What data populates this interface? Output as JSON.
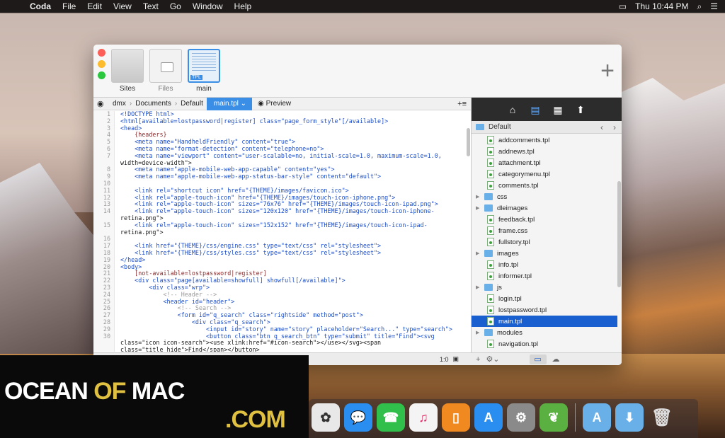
{
  "menubar": {
    "apple": "",
    "app": "Coda",
    "items": [
      "File",
      "Edit",
      "View",
      "Text",
      "Go",
      "Window",
      "Help"
    ],
    "clock": "Thu 10:44 PM"
  },
  "modes": {
    "sites": "Sites",
    "files": "Files",
    "editor": "main",
    "editor_tag": "TPL"
  },
  "path": {
    "segments": [
      "dmx",
      "Documents",
      "Default"
    ],
    "active": "main.tpl",
    "preview": "Preview"
  },
  "code_lines": [
    {
      "n": "1",
      "t": "<!DOCTYPE html>"
    },
    {
      "n": "2",
      "t": "<html[available=lostpassword|register] class=\"page_form_style\"[/available]>"
    },
    {
      "n": "3",
      "t": "<head>"
    },
    {
      "n": "4",
      "t": "    {headers}"
    },
    {
      "n": "5",
      "t": "    <meta name=\"HandheldFriendly\" content=\"true\">"
    },
    {
      "n": "6",
      "t": "    <meta name=\"format-detection\" content=\"telephone=no\">"
    },
    {
      "n": "7",
      "t": "    <meta name=\"viewport\" content=\"user-scalable=no, initial-scale=1.0, maximum-scale=1.0,"
    },
    {
      "n": "",
      "t": "width=device-width\">"
    },
    {
      "n": "8",
      "t": "    <meta name=\"apple-mobile-web-app-capable\" content=\"yes\">"
    },
    {
      "n": "9",
      "t": "    <meta name=\"apple-mobile-web-app-status-bar-style\" content=\"default\">"
    },
    {
      "n": "10",
      "t": ""
    },
    {
      "n": "11",
      "t": "    <link rel=\"shortcut icon\" href=\"{THEME}/images/favicon.ico\">"
    },
    {
      "n": "12",
      "t": "    <link rel=\"apple-touch-icon\" href=\"{THEME}/images/touch-icon-iphone.png\">"
    },
    {
      "n": "13",
      "t": "    <link rel=\"apple-touch-icon\" sizes=\"76x76\" href=\"{THEME}/images/touch-icon-ipad.png\">"
    },
    {
      "n": "14",
      "t": "    <link rel=\"apple-touch-icon\" sizes=\"120x120\" href=\"{THEME}/images/touch-icon-iphone-"
    },
    {
      "n": "",
      "t": "retina.png\">"
    },
    {
      "n": "15",
      "t": "    <link rel=\"apple-touch-icon\" sizes=\"152x152\" href=\"{THEME}/images/touch-icon-ipad-"
    },
    {
      "n": "",
      "t": "retina.png\">"
    },
    {
      "n": "16",
      "t": ""
    },
    {
      "n": "17",
      "t": "    <link href=\"{THEME}/css/engine.css\" type=\"text/css\" rel=\"stylesheet\">"
    },
    {
      "n": "18",
      "t": "    <link href=\"{THEME}/css/styles.css\" type=\"text/css\" rel=\"stylesheet\">"
    },
    {
      "n": "19",
      "t": "</head>"
    },
    {
      "n": "20",
      "t": "<body>"
    },
    {
      "n": "21",
      "t": "    [not-available=lostpassword|register]"
    },
    {
      "n": "22",
      "t": "    <div class=\"page[available=showfull] showfull[/available]\">"
    },
    {
      "n": "23",
      "t": "        <div class=\"wrp\">"
    },
    {
      "n": "24",
      "t": "            <!-- Header -->"
    },
    {
      "n": "25",
      "t": "            <header id=\"header\">"
    },
    {
      "n": "26",
      "t": "                <!-- Search -->"
    },
    {
      "n": "27",
      "t": "                <form id=\"q_search\" class=\"rightside\" method=\"post\">"
    },
    {
      "n": "28",
      "t": "                    <div class=\"q_search\">"
    },
    {
      "n": "29",
      "t": "                        <input id=\"story\" name=\"story\" placeholder=\"Search...\" type=\"search\">"
    },
    {
      "n": "30",
      "t": "                        <button class=\"btn q_search_btn\" type=\"submit\" title=\"Find\"><svg"
    },
    {
      "n": "",
      "t": "class=\"icon icon-search\"><use xlink:href=\"#icon-search\"></use></svg><span"
    },
    {
      "n": "",
      "t": "class=\"title_hide\">Find</span></button>"
    }
  ],
  "status": {
    "position": "1:0"
  },
  "sidebar": {
    "folder": "Default",
    "files": [
      {
        "name": "addcomments.tpl",
        "kind": "file"
      },
      {
        "name": "addnews.tpl",
        "kind": "file"
      },
      {
        "name": "attachment.tpl",
        "kind": "file"
      },
      {
        "name": "categorymenu.tpl",
        "kind": "file"
      },
      {
        "name": "comments.tpl",
        "kind": "file"
      },
      {
        "name": "css",
        "kind": "folder"
      },
      {
        "name": "dleimages",
        "kind": "folder"
      },
      {
        "name": "feedback.tpl",
        "kind": "file"
      },
      {
        "name": "frame.css",
        "kind": "file"
      },
      {
        "name": "fullstory.tpl",
        "kind": "file"
      },
      {
        "name": "images",
        "kind": "folder"
      },
      {
        "name": "info.tpl",
        "kind": "file"
      },
      {
        "name": "informer.tpl",
        "kind": "file"
      },
      {
        "name": "js",
        "kind": "folder"
      },
      {
        "name": "login.tpl",
        "kind": "file"
      },
      {
        "name": "lostpassword.tpl",
        "kind": "file"
      },
      {
        "name": "main.tpl",
        "kind": "file",
        "selected": true
      },
      {
        "name": "modules",
        "kind": "folder"
      },
      {
        "name": "navigation.tpl",
        "kind": "file"
      }
    ]
  },
  "watermark": {
    "line1a": "OCEAN ",
    "line1b": "OF",
    "line1c": " MAC",
    "line2": ".COM"
  },
  "colors": {
    "accent": "#3a8ee6",
    "selection": "#1a5fd0"
  }
}
